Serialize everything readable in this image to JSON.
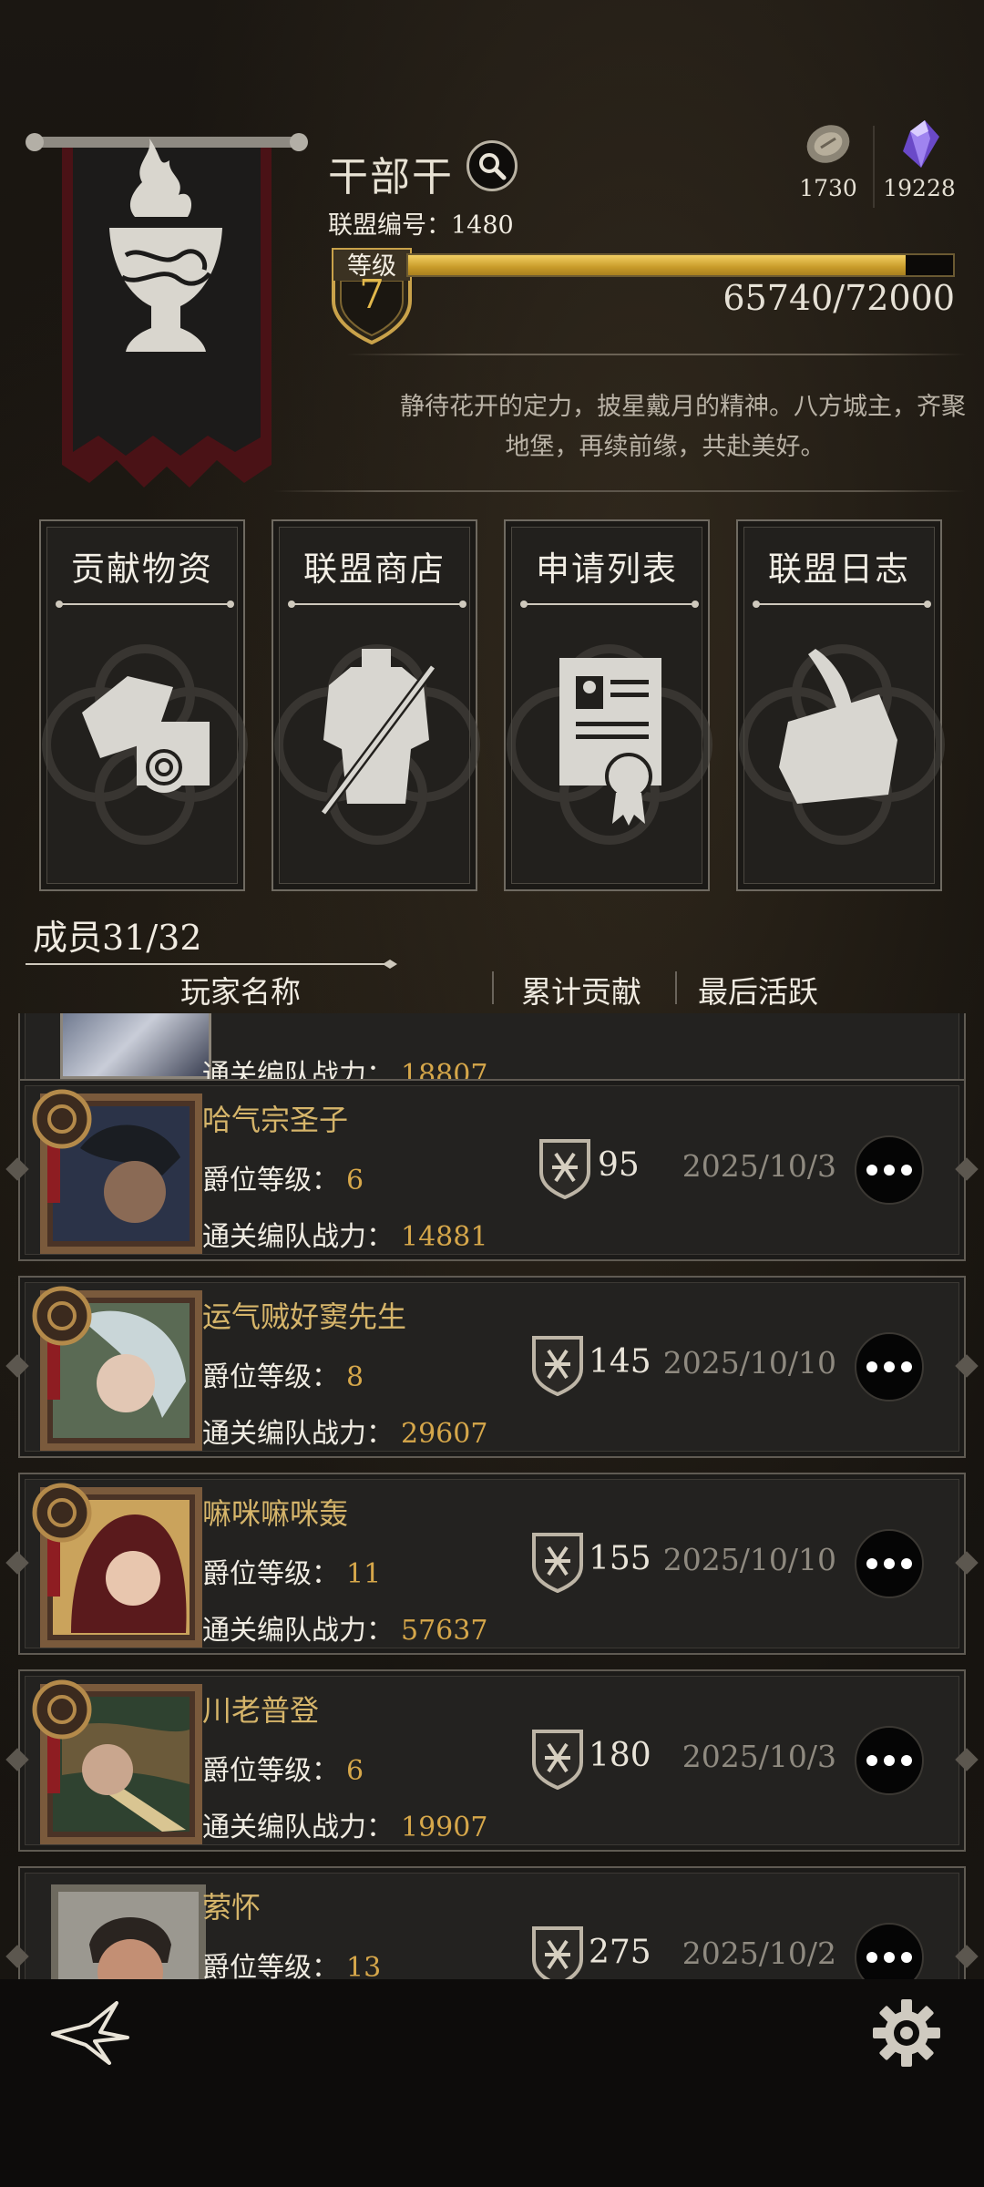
{
  "alliance": {
    "name": "干部干",
    "id_label": "联盟编号：",
    "id_value": "1480",
    "level_label": "等级",
    "level": "7",
    "xp_text": "65740/72000",
    "xp_progress": 0.913,
    "motto_line1": "静待花开的定力，披星戴月的精神。八方城主，齐聚",
    "motto_line2": "地堡，再续前缘，共赴美好。"
  },
  "resources": [
    {
      "icon": "coin-icon",
      "value": "1730"
    },
    {
      "icon": "crystal-icon",
      "value": "19228"
    }
  ],
  "actions": [
    {
      "label": "贡献物资",
      "icon": "scroll-map-icon"
    },
    {
      "label": "联盟商店",
      "icon": "armor-sword-icon"
    },
    {
      "label": "申请列表",
      "icon": "certificate-icon"
    },
    {
      "label": "联盟日志",
      "icon": "quill-paper-icon"
    }
  ],
  "members": {
    "count_label": "成员31/32",
    "columns": [
      "玩家名称",
      "累计贡献",
      "最后活跃"
    ],
    "rank_label": "爵位等级：",
    "power_label": "通关编队战力：",
    "partial_top_power": "18807",
    "rows": [
      {
        "name": "哈气宗圣子",
        "rank": "6",
        "power": "14881",
        "contribution": "95",
        "last_active": "2025/10/3"
      },
      {
        "name": "运气贼好窦先生",
        "rank": "8",
        "power": "29607",
        "contribution": "145",
        "last_active": "2025/10/10"
      },
      {
        "name": "嘛咪嘛咪轰",
        "rank": "11",
        "power": "57637",
        "contribution": "155",
        "last_active": "2025/10/10"
      },
      {
        "name": "川老普登",
        "rank": "6",
        "power": "19907",
        "contribution": "180",
        "last_active": "2025/10/3"
      },
      {
        "name": "萦怀",
        "rank": "13",
        "power": "",
        "contribution": "275",
        "last_active": "2025/10/2"
      }
    ]
  },
  "colors": {
    "accent_gold": "#d6a74a",
    "name_gold": "#d6b56a",
    "xp_fill": "#e0b545",
    "banner_red": "#7a1e22"
  },
  "bottom_nav": {
    "back_icon": "back-arrow-icon",
    "settings_icon": "gear-icon"
  }
}
